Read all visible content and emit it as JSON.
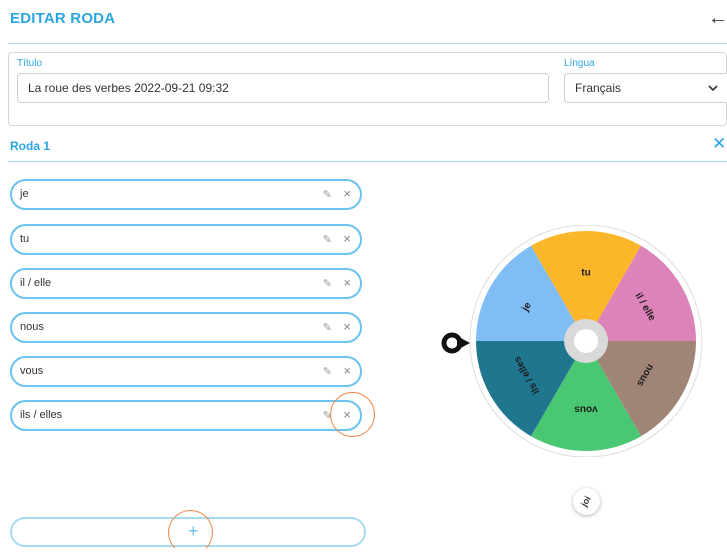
{
  "header": {
    "title": "EDITAR RODA",
    "back_icon": "arrow-left-icon"
  },
  "form": {
    "title_label": "Título",
    "title_value": "La roue des verbes 2022-09-21 09:32",
    "language_label": "Língua",
    "language_value": "Français"
  },
  "wheel_section": {
    "title": "Roda 1",
    "close_icon": "close-icon"
  },
  "items": [
    {
      "label": "je"
    },
    {
      "label": "tu"
    },
    {
      "label": "il / elle"
    },
    {
      "label": "nous"
    },
    {
      "label": "vous"
    },
    {
      "label": "ils / elles"
    }
  ],
  "item_edit_glyph": "✎",
  "item_delete_glyph": "×",
  "add_glyph": "+",
  "spin_label": "joi",
  "wheel": {
    "segments": [
      {
        "label": "tu",
        "color": "#fbb62a"
      },
      {
        "label": "il / elle",
        "color": "#dc83b9"
      },
      {
        "label": "nous",
        "color": "#a08577"
      },
      {
        "label": "vous",
        "color": "#49c772"
      },
      {
        "label": "ils / elles",
        "color": "#21768f"
      },
      {
        "label": "je",
        "color": "#7fbdf4"
      }
    ]
  },
  "colors": {
    "accent": "#2aa6e0",
    "pill_border": "#6cc3ef",
    "highlight": "#f08a4b"
  }
}
